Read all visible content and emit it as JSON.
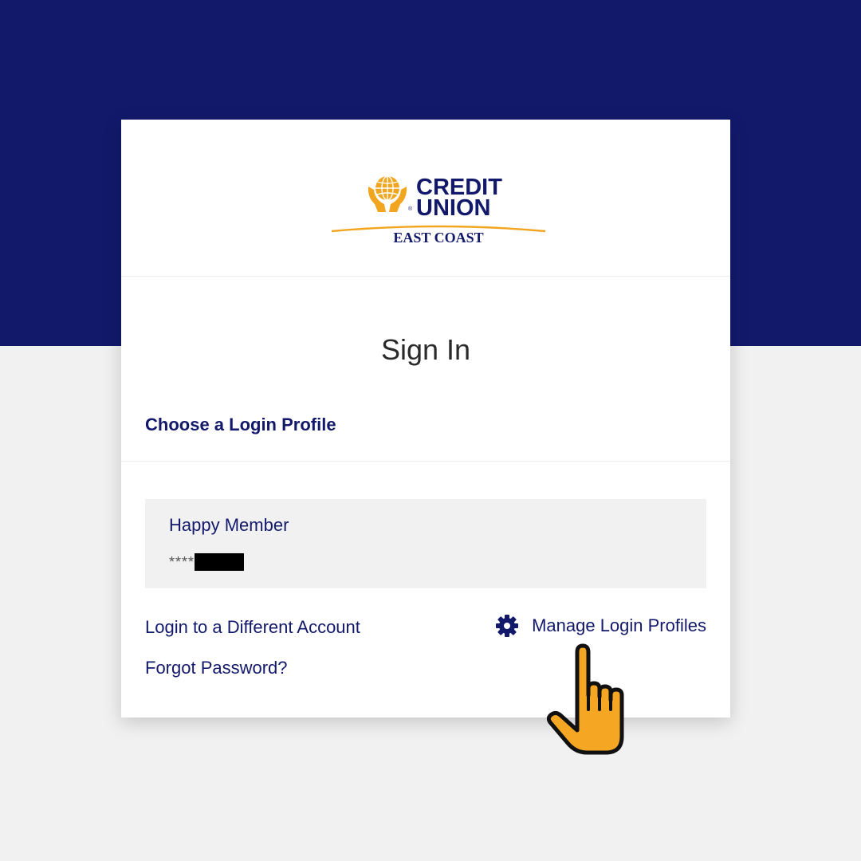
{
  "brand": {
    "logo_line1": "CREDIT",
    "logo_line2": "UNION",
    "logo_line3": "EAST COAST",
    "logo_mark": "®",
    "navy": "#12196b",
    "gold": "#f2a51f"
  },
  "signin": {
    "title": "Sign In",
    "choose_profile_label": "Choose a Login Profile"
  },
  "profile": {
    "name": "Happy Member",
    "account_mask": "****"
  },
  "links": {
    "different_account": "Login to a Different Account",
    "forgot_password": "Forgot Password?",
    "manage_profiles": "Manage Login Profiles"
  },
  "icons": {
    "manage": "gear-icon",
    "pointer": "pointing-hand-icon"
  }
}
